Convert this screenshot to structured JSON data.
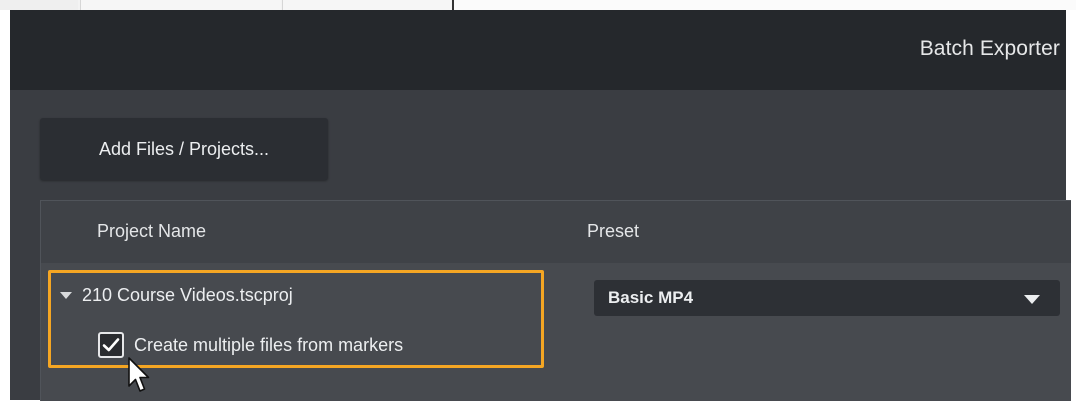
{
  "window": {
    "title": "Batch Exporter"
  },
  "toolbar": {
    "add_files_label": "Add Files / Projects..."
  },
  "table": {
    "columns": {
      "project_name": "Project Name",
      "preset": "Preset"
    },
    "rows": [
      {
        "project_name": "210 Course Videos.tscproj",
        "preset": "Basic MP4",
        "expanded": true,
        "option_label": "Create multiple files from markers",
        "option_checked": true
      }
    ]
  },
  "colors": {
    "highlight": "#f5a623",
    "titlebar": "#25282c",
    "window_bg": "#3a3d42"
  },
  "icons": [
    "disclosure-triangle-icon",
    "checkmark-icon",
    "dropdown-caret-icon",
    "mouse-pointer-icon"
  ]
}
